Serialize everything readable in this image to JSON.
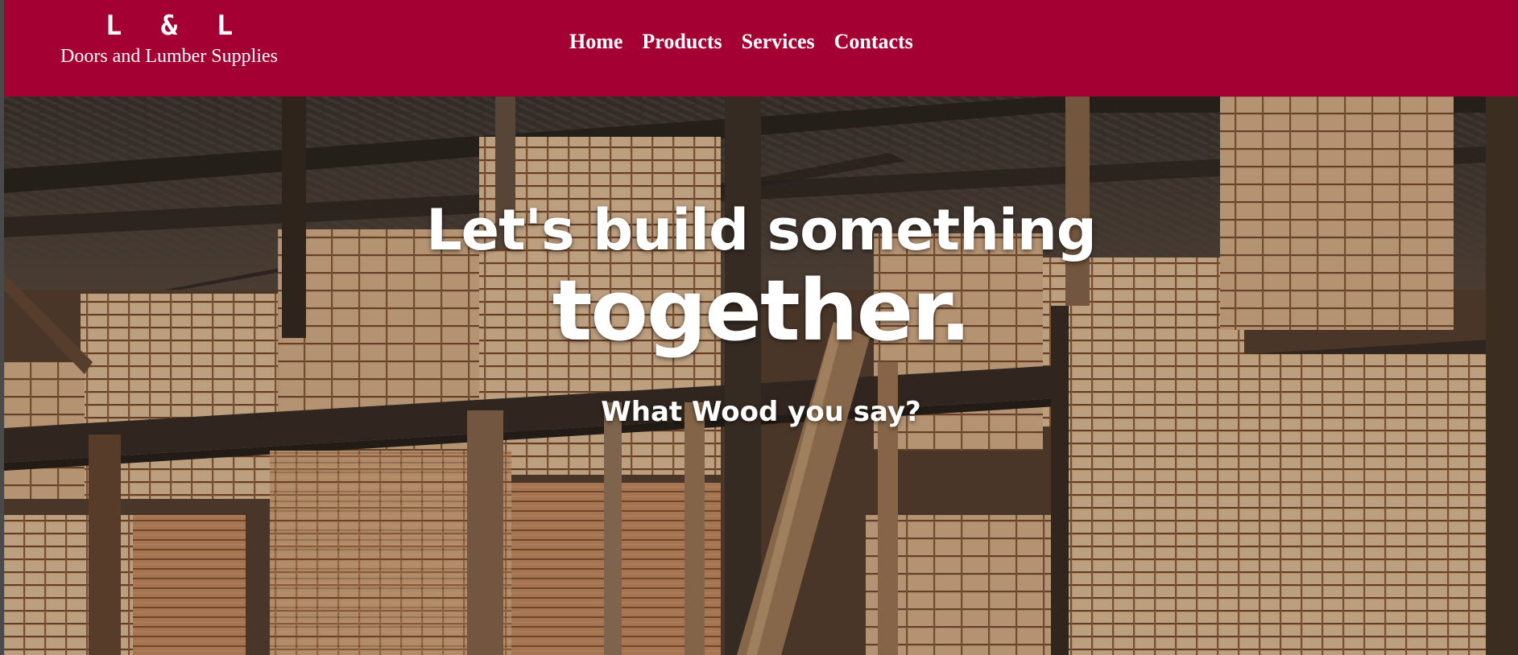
{
  "brand": {
    "mark": "L & L",
    "name": "Doors and Lumber Supplies"
  },
  "nav": {
    "items": [
      {
        "label": "Home"
      },
      {
        "label": "Products"
      },
      {
        "label": "Services"
      },
      {
        "label": "Contacts"
      }
    ]
  },
  "hero": {
    "heading_line1": "Let's build something",
    "heading_line2": "together.",
    "subheading": "What Wood you say?",
    "background": "lumber-warehouse-photo"
  },
  "colors": {
    "header_bg": "#a50034",
    "text": "#ffffff"
  }
}
